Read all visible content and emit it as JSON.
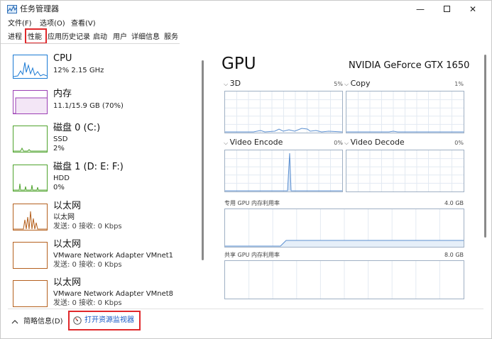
{
  "window": {
    "title": "任务管理器",
    "minimize": "—",
    "close": "✕"
  },
  "menu": [
    {
      "label": "文件(F)"
    },
    {
      "label": "选项(O)"
    },
    {
      "label": "查看(V)"
    }
  ],
  "tabs": [
    {
      "label": "进程"
    },
    {
      "label": "性能",
      "active": true
    },
    {
      "label": "应用历史记录"
    },
    {
      "label": "启动"
    },
    {
      "label": "用户"
    },
    {
      "label": "详细信息"
    },
    {
      "label": "服务"
    }
  ],
  "resources": [
    {
      "name": "CPU",
      "lines": [
        "12% 2.15 GHz"
      ],
      "color": "#1a7ad4"
    },
    {
      "name": "内存",
      "lines": [
        "11.1/15.9 GB (70%)"
      ],
      "color": "#9b3fb4"
    },
    {
      "name": "磁盘 0 (C:)",
      "lines": [
        "SSD",
        "2%"
      ],
      "color": "#4fa32d"
    },
    {
      "name": "磁盘 1 (D: E: F:)",
      "lines": [
        "HDD",
        "0%"
      ],
      "color": "#4fa32d"
    },
    {
      "name": "以太网",
      "lines": [
        "以太网",
        "发送: 0 接收: 0 Kbps"
      ],
      "color": "#b5611f"
    },
    {
      "name": "以太网",
      "lines": [
        "VMware Network Adapter VMnet1",
        "发送: 0 接收: 0 Kbps"
      ],
      "color": "#b5611f"
    },
    {
      "name": "以太网",
      "lines": [
        "VMware Network Adapter VMnet8",
        "发送: 0 接收: 0 Kbps"
      ],
      "color": "#b5611f"
    }
  ],
  "gpu": {
    "title": "GPU",
    "model": "NVIDIA GeForce GTX 1650",
    "engines": [
      {
        "label": "3D",
        "percent": "5%"
      },
      {
        "label": "Copy",
        "percent": "1%"
      },
      {
        "label": "Video Encode",
        "percent": "0%"
      },
      {
        "label": "Video Decode",
        "percent": "0%"
      }
    ],
    "dedicated": {
      "label": "专用 GPU 内存利用率",
      "max": "4.0 GB"
    },
    "shared": {
      "label": "共享 GPU 内存利用率",
      "max": "8.0 GB"
    },
    "graph_color": "#5b8fd0"
  },
  "footer": {
    "summary": "简略信息(D)",
    "open_monitor": "打开资源监视器"
  },
  "accent_red": "#e0282b"
}
